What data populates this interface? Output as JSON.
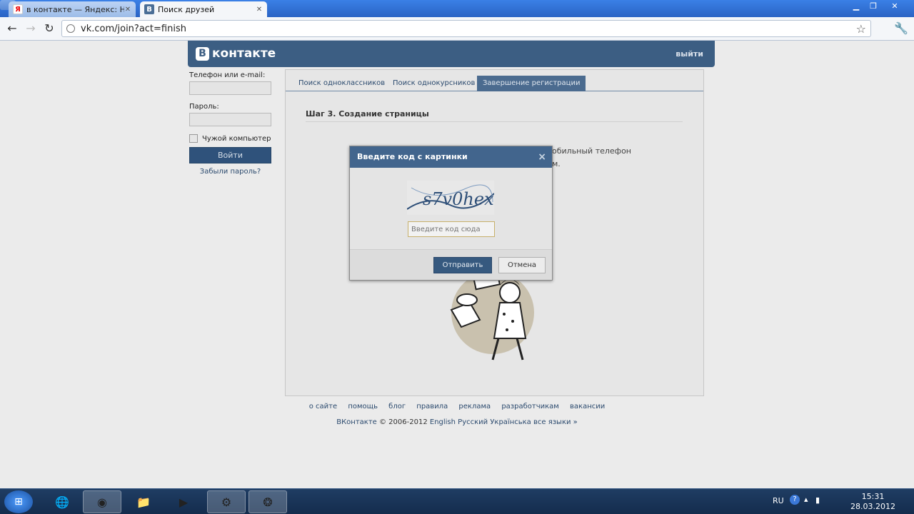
{
  "browser": {
    "tabs": [
      {
        "title": "в контакте — Яндекс: Наш",
        "favicon": "Я",
        "active": false
      },
      {
        "title": "Поиск друзей",
        "favicon": "B",
        "active": true
      }
    ],
    "address": "vk.com/join?act=finish"
  },
  "vk": {
    "logo_letter": "B",
    "logo_text": "контакте",
    "logout": "выйти",
    "login": {
      "phone_label": "Телефон или e-mail:",
      "password_label": "Пароль:",
      "foreign_pc": "Чужой компьютер",
      "login_button": "Войти",
      "forgot": "Забыли пароль?"
    },
    "tabs": [
      "Поиск одноклассников",
      "Поиск однокурсников",
      "Завершение регистрации"
    ],
    "step_title": "Шаг 3. Создание страницы",
    "hint_line1": "обильный телефон",
    "hint_line2": "м.",
    "footer_links": [
      "о сайте",
      "помощь",
      "блог",
      "правила",
      "реклама",
      "разработчикам",
      "вакансии"
    ],
    "footer_copy": {
      "brand": "ВКонтакте",
      "years": "© 2006-2012",
      "langs": "English Русский Українська все языки »"
    }
  },
  "modal": {
    "title": "Введите код с картинки",
    "close": "×",
    "captcha_text": "s7v0hex",
    "input_placeholder": "Введите код сюда",
    "send_button": "Отправить",
    "cancel_button": "Отмена"
  },
  "taskbar": {
    "lang": "RU",
    "time": "15:31",
    "date": "28.03.2012"
  },
  "colors": {
    "vk_blue": "#3c5e83",
    "modal_header": "#42658d",
    "link": "#2b4a6e"
  }
}
